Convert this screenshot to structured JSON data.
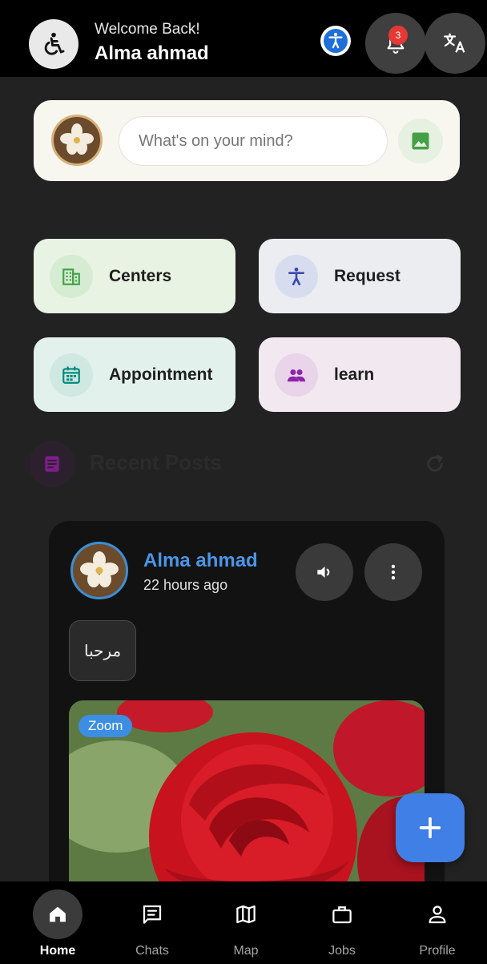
{
  "header": {
    "greeting": "Welcome Back!",
    "username": "Alma ahmad",
    "notification_count": "3"
  },
  "composer": {
    "placeholder": "What's on your mind?"
  },
  "quick_actions": [
    {
      "label": "Centers",
      "icon": "building-icon",
      "color": "#43a047"
    },
    {
      "label": "Request",
      "icon": "accessibility-icon",
      "color": "#3949ab"
    },
    {
      "label": "Appointment",
      "icon": "calendar-icon",
      "color": "#00897b"
    },
    {
      "label": "learn",
      "icon": "group-icon",
      "color": "#8e24aa"
    }
  ],
  "recent_posts": {
    "title": "Recent Posts"
  },
  "post": {
    "author": "Alma ahmad",
    "time": "22 hours ago",
    "text": "مرحبا",
    "zoom_label": "Zoom"
  },
  "bottom_nav": [
    {
      "label": "Home",
      "icon": "home-icon",
      "active": true
    },
    {
      "label": "Chats",
      "icon": "chat-icon",
      "active": false
    },
    {
      "label": "Map",
      "icon": "map-icon",
      "active": false
    },
    {
      "label": "Jobs",
      "icon": "briefcase-icon",
      "active": false
    },
    {
      "label": "Profile",
      "icon": "person-icon",
      "active": false
    }
  ],
  "colors": {
    "accent_blue": "#3f7fe6",
    "author_blue": "#4a96e8",
    "badge_red": "#e53935"
  }
}
